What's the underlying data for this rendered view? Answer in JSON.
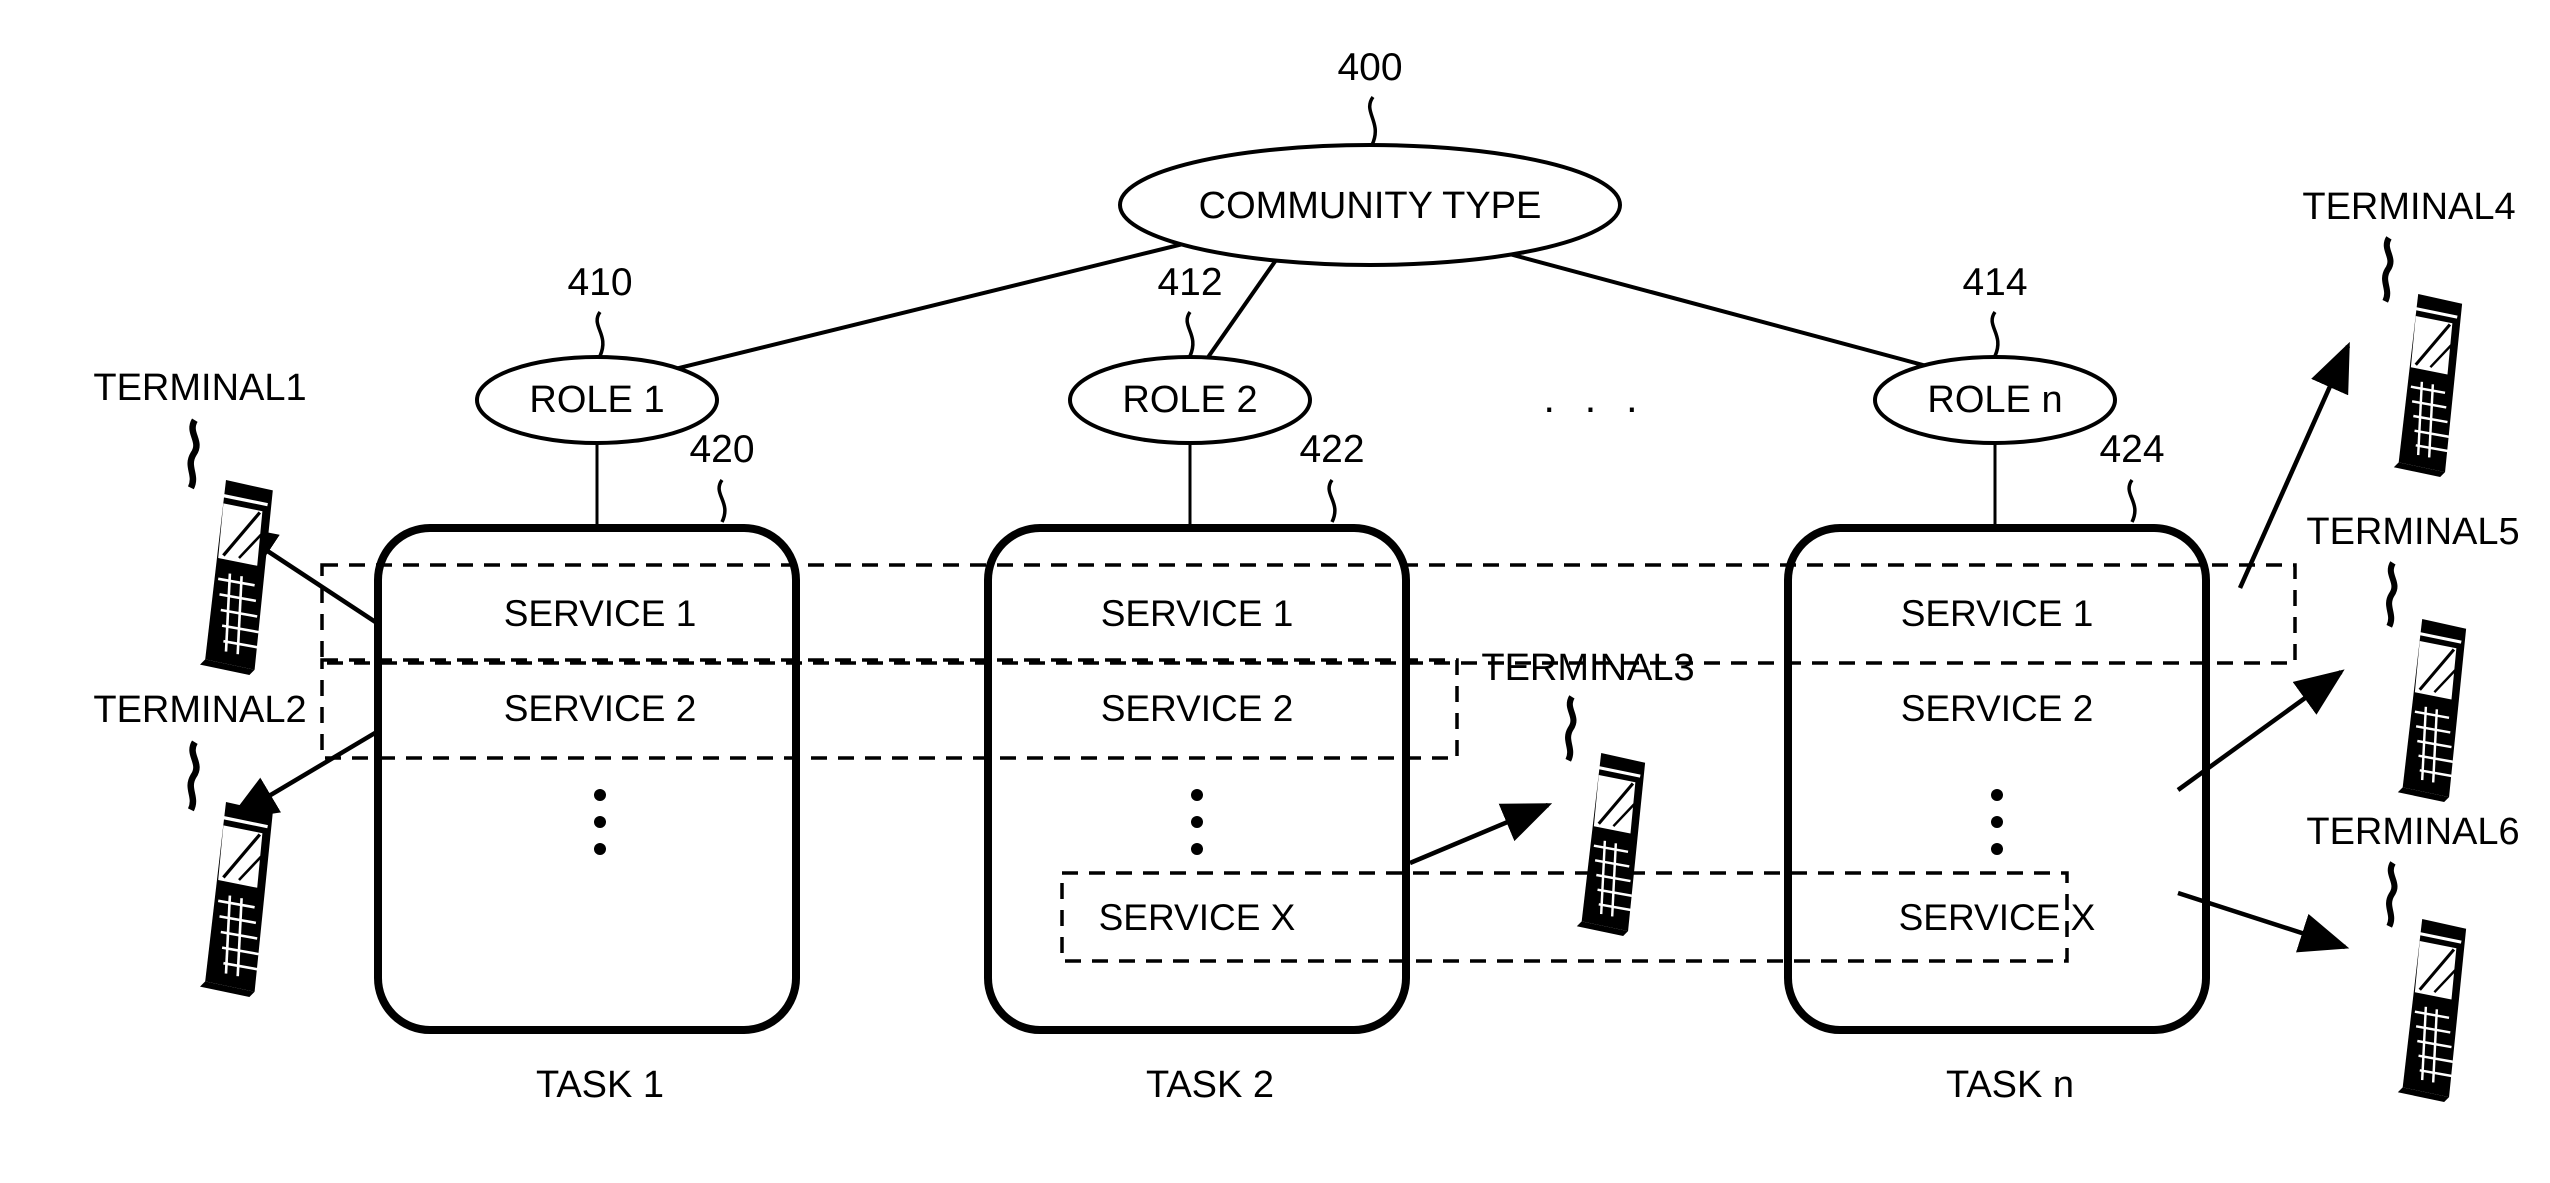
{
  "figure": {
    "type": "patent-diagram",
    "root": {
      "id": "400",
      "label": "COMMUNITY TYPE"
    },
    "roles": [
      {
        "id": "410",
        "label": "ROLE 1"
      },
      {
        "id": "412",
        "label": "ROLE 2"
      },
      {
        "id": "414",
        "label": "ROLE n"
      }
    ],
    "role_ellipsis": ". . .",
    "tasks": [
      {
        "id": "420",
        "label": "TASK 1",
        "services": [
          "SERVICE 1",
          "SERVICE 2"
        ],
        "vertical_ellipsis": true,
        "service_x": ""
      },
      {
        "id": "422",
        "label": "TASK 2",
        "services": [
          "SERVICE 1",
          "SERVICE 2"
        ],
        "vertical_ellipsis": true,
        "service_x": "SERVICE X"
      },
      {
        "id": "424",
        "label": "TASK n",
        "services": [
          "SERVICE 1",
          "SERVICE 2"
        ],
        "vertical_ellipsis": true,
        "service_x": "SERVICE X"
      }
    ],
    "terminals": [
      {
        "label": "TERMINAL1"
      },
      {
        "label": "TERMINAL2"
      },
      {
        "label": "TERMINAL3"
      },
      {
        "label": "TERMINAL4"
      },
      {
        "label": "TERMINAL5"
      },
      {
        "label": "TERMINAL6"
      }
    ],
    "colors": {
      "stroke": "#000000",
      "background": "#ffffff"
    }
  }
}
